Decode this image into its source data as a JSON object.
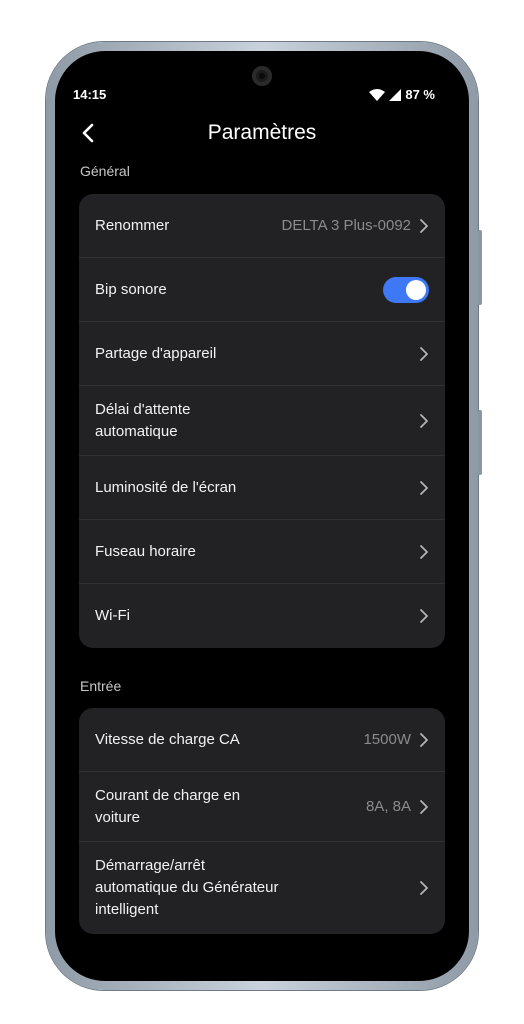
{
  "status": {
    "time": "14:15",
    "battery": "87 %"
  },
  "header": {
    "title": "Paramètres"
  },
  "sections": [
    {
      "label": "Général",
      "items": [
        {
          "label": "Renommer",
          "value": "DELTA 3 Plus-0092"
        },
        {
          "label": "Bip sonore",
          "toggle": true
        },
        {
          "label": "Partage d'appareil"
        },
        {
          "label": "Délai d'attente automatique"
        },
        {
          "label": "Luminosité de l'écran"
        },
        {
          "label": "Fuseau horaire"
        },
        {
          "label": "Wi-Fi"
        }
      ]
    },
    {
      "label": "Entrée",
      "items": [
        {
          "label": "Vitesse de charge CA",
          "value": "1500W"
        },
        {
          "label": "Courant de charge en voiture",
          "value": "8A, 8A"
        },
        {
          "label": "Démarrage/arrêt automatique du Générateur intelligent"
        }
      ]
    }
  ],
  "colors": {
    "accent": "#3e78f4",
    "card": "#222224",
    "background": "#000000"
  }
}
